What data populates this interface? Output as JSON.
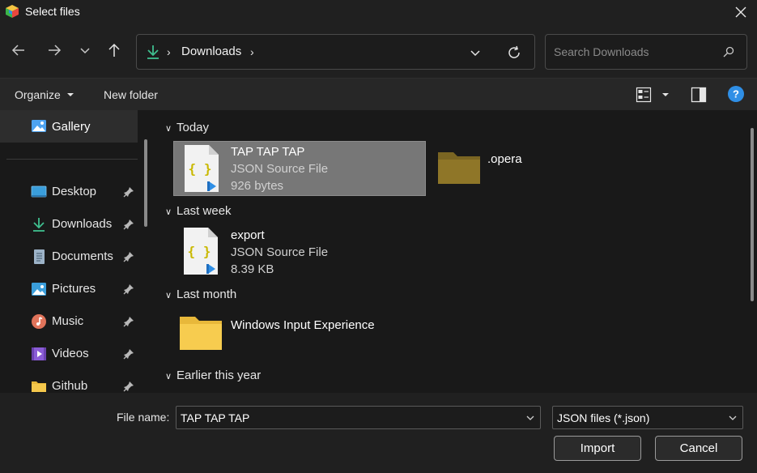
{
  "window": {
    "title": "Select files"
  },
  "nav": {
    "location": "Downloads",
    "search_placeholder": "Search Downloads"
  },
  "toolbar": {
    "organize_label": "Organize",
    "new_folder_label": "New folder"
  },
  "sidebar": {
    "gallery": "Gallery",
    "items": [
      {
        "label": "Desktop",
        "icon": "desktop-icon",
        "pinned": true
      },
      {
        "label": "Downloads",
        "icon": "downloads-icon",
        "pinned": true
      },
      {
        "label": "Documents",
        "icon": "documents-icon",
        "pinned": true
      },
      {
        "label": "Pictures",
        "icon": "pictures-icon",
        "pinned": true
      },
      {
        "label": "Music",
        "icon": "music-icon",
        "pinned": true
      },
      {
        "label": "Videos",
        "icon": "videos-icon",
        "pinned": true
      },
      {
        "label": "Github",
        "icon": "folder-icon",
        "pinned": true
      }
    ]
  },
  "groups": {
    "today": {
      "header": "Today",
      "files": [
        {
          "name": "TAP TAP TAP",
          "type": "JSON Source File",
          "size": "926 bytes",
          "icon": "json-file-icon",
          "selected": true
        },
        {
          "name": ".opera",
          "icon": "folder-icon"
        }
      ]
    },
    "last_week": {
      "header": "Last week",
      "files": [
        {
          "name": "export",
          "type": "JSON Source File",
          "size": "8.39 KB",
          "icon": "json-file-icon"
        }
      ]
    },
    "last_month": {
      "header": "Last month",
      "files": [
        {
          "name": "Windows Input Experience",
          "icon": "folder-icon"
        }
      ]
    },
    "earlier": {
      "header": "Earlier this year"
    }
  },
  "footer": {
    "file_name_label": "File name:",
    "file_name_value": "TAP TAP TAP",
    "file_type_value": "JSON files (*.json)",
    "import_label": "Import",
    "cancel_label": "Cancel"
  },
  "colors": {
    "accent_green": "#3fbf8f",
    "help_blue": "#2f8fe6",
    "folder_yellow": "#f2c447",
    "selection": "#777777"
  }
}
